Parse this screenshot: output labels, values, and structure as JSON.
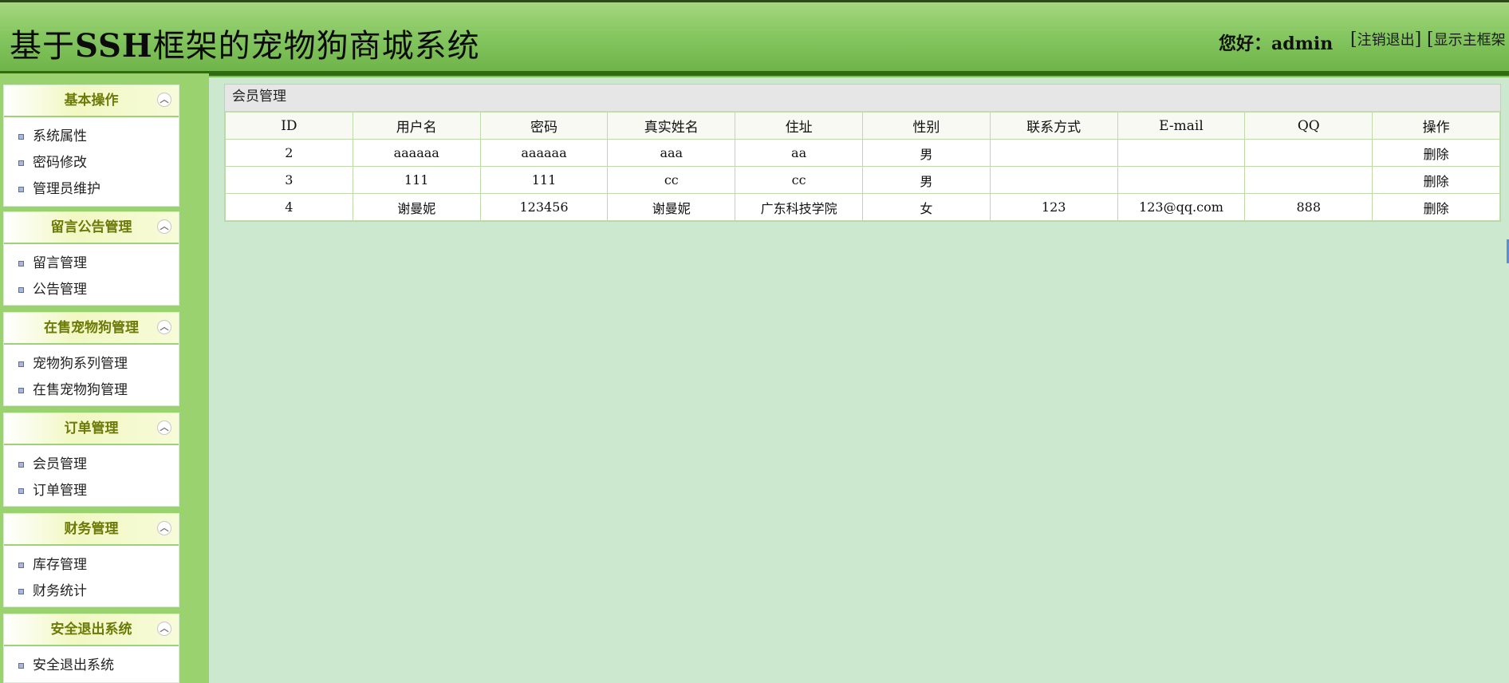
{
  "header": {
    "title_pre": "基于",
    "title_bold": "SSH",
    "title_post": "框架的宠物狗商城系统",
    "greeting": "您好：admin",
    "logout": "注销退出",
    "show_main": "显示主框架"
  },
  "sidebar": {
    "groups": [
      {
        "title": "基本操作",
        "items": [
          "系统属性",
          "密码修改",
          "管理员维护"
        ]
      },
      {
        "title": "留言公告管理",
        "items": [
          "留言管理",
          "公告管理"
        ]
      },
      {
        "title": "在售宠物狗管理",
        "items": [
          "宠物狗系列管理",
          "在售宠物狗管理"
        ]
      },
      {
        "title": "订单管理",
        "items": [
          "会员管理",
          "订单管理"
        ]
      },
      {
        "title": "财务管理",
        "items": [
          "库存管理",
          "财务统计"
        ]
      },
      {
        "title": "安全退出系统",
        "items": [
          "安全退出系统"
        ]
      }
    ]
  },
  "main": {
    "title": "会员管理",
    "columns": [
      "ID",
      "用户名",
      "密码",
      "真实姓名",
      "住址",
      "性别",
      "联系方式",
      "E-mail",
      "QQ",
      "操作"
    ],
    "rows": [
      [
        "2",
        "aaaaaa",
        "aaaaaa",
        "aaa",
        "aa",
        "男",
        "",
        "",
        "",
        "删除"
      ],
      [
        "3",
        "111",
        "111",
        "cc",
        "cc",
        "男",
        "",
        "",
        "",
        "删除"
      ],
      [
        "4",
        "谢曼妮",
        "123456",
        "谢曼妮",
        "广东科技学院",
        "女",
        "123",
        "123@qq.com",
        "888",
        "删除"
      ]
    ]
  },
  "colors": {
    "header_green": "#86c761",
    "sidebar_green": "#9bd270",
    "content_bg": "#cce8cf",
    "group_title": "#6b7a08"
  }
}
